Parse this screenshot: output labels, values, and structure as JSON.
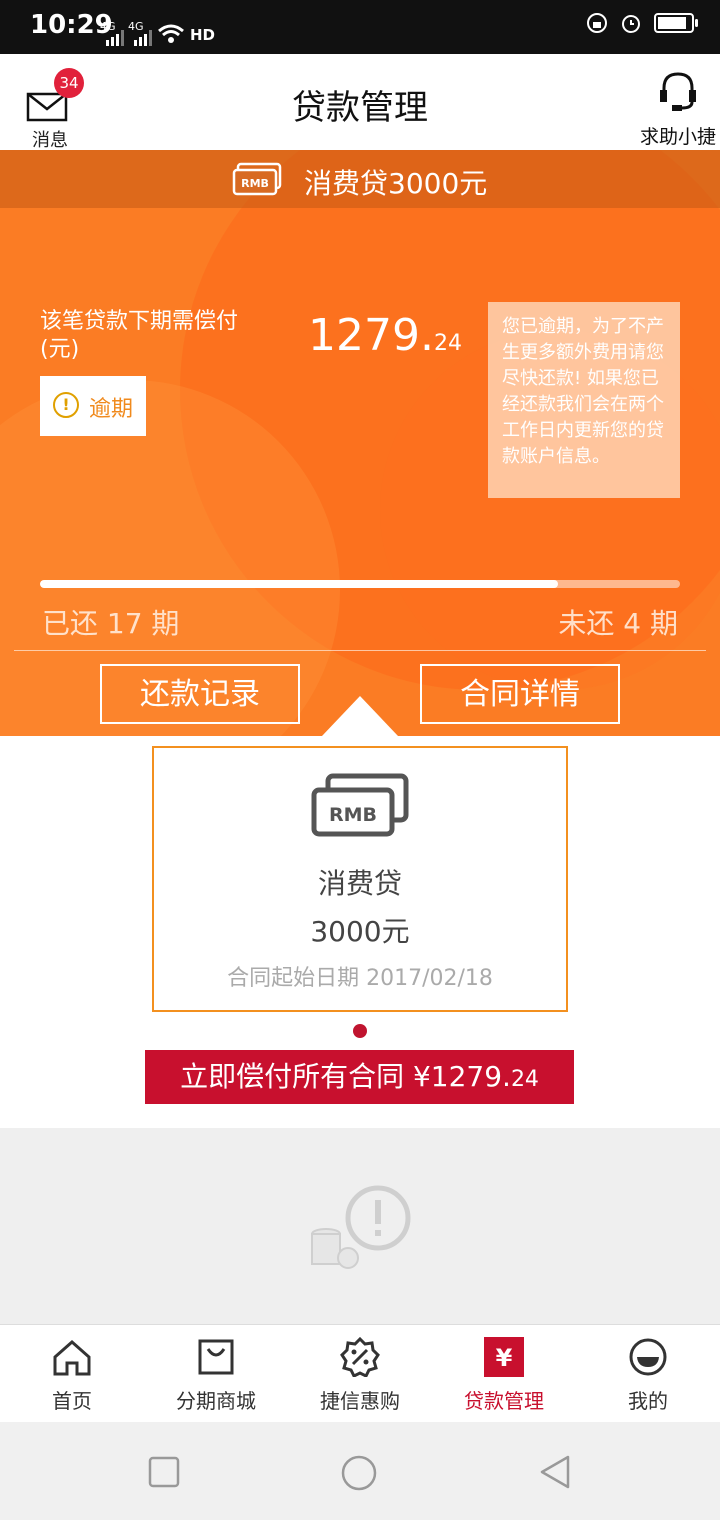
{
  "status_bar": {
    "time": "10:29",
    "signal1": "4G",
    "signal2": "4G",
    "hd": "HD"
  },
  "header": {
    "title": "贷款管理",
    "messages_label": "消息",
    "messages_badge": "34",
    "help_label": "求助小捷"
  },
  "loan_panel": {
    "banner_title": "消费贷3000元",
    "next_payment_label": "该笔贷款下期需偿付(元)",
    "amount_int": "1279.",
    "amount_dec": "24",
    "status": "逾期",
    "overdue_notice": "您已逾期，为了不产生更多额外费用请您尽快还款! 如果您已经还款我们会在两个工作日内更新您的贷款账户信息。",
    "paid_text": "已还 17 期",
    "unpaid_text": "未还 4 期",
    "progress_fraction": 0.81,
    "record_button": "还款记录",
    "contract_button": "合同详情"
  },
  "contract_card": {
    "rmb_icon_text": "RMB",
    "name": "消费贷",
    "amount": "3000元",
    "start_date": "合同起始日期 2017/02/18"
  },
  "pay_all_button": {
    "main": "立即偿付所有合同 ¥1279.",
    "decimals": "24"
  },
  "bottom_nav": [
    {
      "label": "首页",
      "icon": "home-icon"
    },
    {
      "label": "分期商城",
      "icon": "shopping-bag-icon"
    },
    {
      "label": "捷信惠购",
      "icon": "discount-badge-icon"
    },
    {
      "label": "贷款管理",
      "icon": "yen-icon",
      "active": true
    },
    {
      "label": "我的",
      "icon": "profile-icon"
    }
  ],
  "colors": {
    "orange": "#fb7c24",
    "accent_red": "#c8102e",
    "card_border": "#f3901f"
  }
}
